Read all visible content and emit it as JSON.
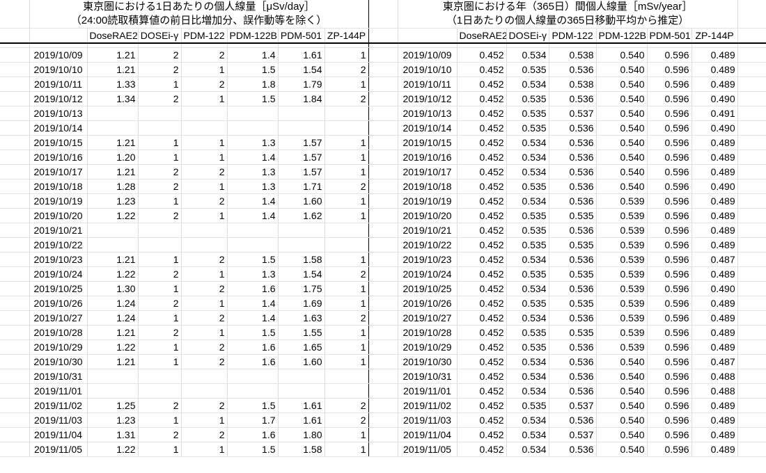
{
  "left_title_line1": "東京圏における1日あたりの個人線量［μSv/day］",
  "left_title_line2": "（24:00読取積算値の前日比増加分、誤作動等を除く）",
  "right_title_line1": "東京圏における年（365日）間個人線量［mSv/year］",
  "right_title_line2": "（1日あたりの個人線量の365日移動平均から推定）",
  "columns": [
    "DoseRAE2",
    "DOSEi-γ",
    "PDM-122",
    "PDM-122B",
    "PDM-501",
    "ZP-144P"
  ],
  "rows": [
    {
      "date": "2019/10/09",
      "daily": [
        "1.21",
        "2",
        "2",
        "1.4",
        "1.61",
        "1"
      ],
      "annual": [
        "0.452",
        "0.534",
        "0.538",
        "0.540",
        "0.596",
        "0.489"
      ]
    },
    {
      "date": "2019/10/10",
      "daily": [
        "1.21",
        "2",
        "1",
        "1.5",
        "1.54",
        "2"
      ],
      "annual": [
        "0.452",
        "0.535",
        "0.536",
        "0.540",
        "0.596",
        "0.489"
      ]
    },
    {
      "date": "2019/10/11",
      "daily": [
        "1.33",
        "1",
        "2",
        "1.8",
        "1.79",
        "1"
      ],
      "annual": [
        "0.452",
        "0.534",
        "0.538",
        "0.540",
        "0.596",
        "0.489"
      ]
    },
    {
      "date": "2019/10/12",
      "daily": [
        "1.34",
        "2",
        "1",
        "1.5",
        "1.84",
        "2"
      ],
      "annual": [
        "0.452",
        "0.535",
        "0.536",
        "0.540",
        "0.596",
        "0.490"
      ]
    },
    {
      "date": "2019/10/13",
      "daily": [
        "",
        "",
        "",
        "",
        "",
        ""
      ],
      "annual": [
        "0.452",
        "0.535",
        "0.537",
        "0.540",
        "0.596",
        "0.491"
      ]
    },
    {
      "date": "2019/10/14",
      "daily": [
        "",
        "",
        "",
        "",
        "",
        ""
      ],
      "annual": [
        "0.452",
        "0.535",
        "0.536",
        "0.540",
        "0.596",
        "0.490"
      ]
    },
    {
      "date": "2019/10/15",
      "daily": [
        "1.21",
        "1",
        "1",
        "1.3",
        "1.57",
        "1"
      ],
      "annual": [
        "0.452",
        "0.534",
        "0.536",
        "0.540",
        "0.596",
        "0.489"
      ]
    },
    {
      "date": "2019/10/16",
      "daily": [
        "1.20",
        "1",
        "1",
        "1.4",
        "1.57",
        "1"
      ],
      "annual": [
        "0.452",
        "0.534",
        "0.536",
        "0.540",
        "0.596",
        "0.489"
      ]
    },
    {
      "date": "2019/10/17",
      "daily": [
        "1.21",
        "2",
        "2",
        "1.3",
        "1.57",
        "1"
      ],
      "annual": [
        "0.452",
        "0.534",
        "0.536",
        "0.540",
        "0.596",
        "0.489"
      ]
    },
    {
      "date": "2019/10/18",
      "daily": [
        "1.28",
        "2",
        "1",
        "1.3",
        "1.71",
        "2"
      ],
      "annual": [
        "0.452",
        "0.535",
        "0.536",
        "0.540",
        "0.596",
        "0.490"
      ]
    },
    {
      "date": "2019/10/19",
      "daily": [
        "1.23",
        "1",
        "2",
        "1.4",
        "1.60",
        "1"
      ],
      "annual": [
        "0.452",
        "0.534",
        "0.536",
        "0.539",
        "0.596",
        "0.489"
      ]
    },
    {
      "date": "2019/10/20",
      "daily": [
        "1.22",
        "2",
        "1",
        "1.4",
        "1.62",
        "1"
      ],
      "annual": [
        "0.452",
        "0.535",
        "0.535",
        "0.539",
        "0.596",
        "0.489"
      ]
    },
    {
      "date": "2019/10/21",
      "daily": [
        "",
        "",
        "",
        "",
        "",
        ""
      ],
      "annual": [
        "0.452",
        "0.535",
        "0.536",
        "0.539",
        "0.596",
        "0.489"
      ]
    },
    {
      "date": "2019/10/22",
      "daily": [
        "",
        "",
        "",
        "",
        "",
        ""
      ],
      "annual": [
        "0.452",
        "0.535",
        "0.535",
        "0.539",
        "0.596",
        "0.489"
      ]
    },
    {
      "date": "2019/10/23",
      "daily": [
        "1.21",
        "1",
        "2",
        "1.5",
        "1.58",
        "1"
      ],
      "annual": [
        "0.452",
        "0.534",
        "0.536",
        "0.539",
        "0.596",
        "0.487"
      ]
    },
    {
      "date": "2019/10/24",
      "daily": [
        "1.22",
        "2",
        "1",
        "1.3",
        "1.54",
        "2"
      ],
      "annual": [
        "0.452",
        "0.535",
        "0.535",
        "0.539",
        "0.596",
        "0.489"
      ]
    },
    {
      "date": "2019/10/25",
      "daily": [
        "1.30",
        "1",
        "2",
        "1.6",
        "1.75",
        "1"
      ],
      "annual": [
        "0.452",
        "0.534",
        "0.536",
        "0.539",
        "0.596",
        "0.490"
      ]
    },
    {
      "date": "2019/10/26",
      "daily": [
        "1.24",
        "2",
        "1",
        "1.4",
        "1.69",
        "1"
      ],
      "annual": [
        "0.452",
        "0.535",
        "0.535",
        "0.539",
        "0.596",
        "0.489"
      ]
    },
    {
      "date": "2019/10/27",
      "daily": [
        "1.24",
        "1",
        "2",
        "1.4",
        "1.63",
        "2"
      ],
      "annual": [
        "0.452",
        "0.534",
        "0.536",
        "0.539",
        "0.596",
        "0.489"
      ]
    },
    {
      "date": "2019/10/28",
      "daily": [
        "1.21",
        "2",
        "1",
        "1.5",
        "1.55",
        "1"
      ],
      "annual": [
        "0.452",
        "0.535",
        "0.535",
        "0.539",
        "0.596",
        "0.489"
      ]
    },
    {
      "date": "2019/10/29",
      "daily": [
        "1.22",
        "1",
        "2",
        "1.6",
        "1.65",
        "1"
      ],
      "annual": [
        "0.452",
        "0.535",
        "0.536",
        "0.539",
        "0.596",
        "0.489"
      ]
    },
    {
      "date": "2019/10/30",
      "daily": [
        "1.21",
        "1",
        "2",
        "1.6",
        "1.60",
        "1"
      ],
      "annual": [
        "0.452",
        "0.534",
        "0.536",
        "0.540",
        "0.596",
        "0.487"
      ]
    },
    {
      "date": "2019/10/31",
      "daily": [
        "",
        "",
        "",
        "",
        "",
        ""
      ],
      "annual": [
        "0.452",
        "0.534",
        "0.536",
        "0.540",
        "0.596",
        "0.488"
      ]
    },
    {
      "date": "2019/11/01",
      "daily": [
        "",
        "",
        "",
        "",
        "",
        ""
      ],
      "annual": [
        "0.452",
        "0.534",
        "0.536",
        "0.540",
        "0.596",
        "0.488"
      ]
    },
    {
      "date": "2019/11/02",
      "daily": [
        "1.25",
        "2",
        "2",
        "1.5",
        "1.61",
        "2"
      ],
      "annual": [
        "0.452",
        "0.535",
        "0.537",
        "0.540",
        "0.596",
        "0.489"
      ]
    },
    {
      "date": "2019/11/03",
      "daily": [
        "1.23",
        "1",
        "1",
        "1.7",
        "1.61",
        "2"
      ],
      "annual": [
        "0.452",
        "0.534",
        "0.536",
        "0.540",
        "0.596",
        "0.489"
      ]
    },
    {
      "date": "2019/11/04",
      "daily": [
        "1.31",
        "2",
        "2",
        "1.6",
        "1.80",
        "1"
      ],
      "annual": [
        "0.452",
        "0.534",
        "0.537",
        "0.540",
        "0.596",
        "0.489"
      ]
    },
    {
      "date": "2019/11/05",
      "daily": [
        "1.22",
        "1",
        "1",
        "1.5",
        "1.58",
        "1"
      ],
      "annual": [
        "0.452",
        "0.534",
        "0.536",
        "0.540",
        "0.596",
        "0.489"
      ]
    }
  ]
}
